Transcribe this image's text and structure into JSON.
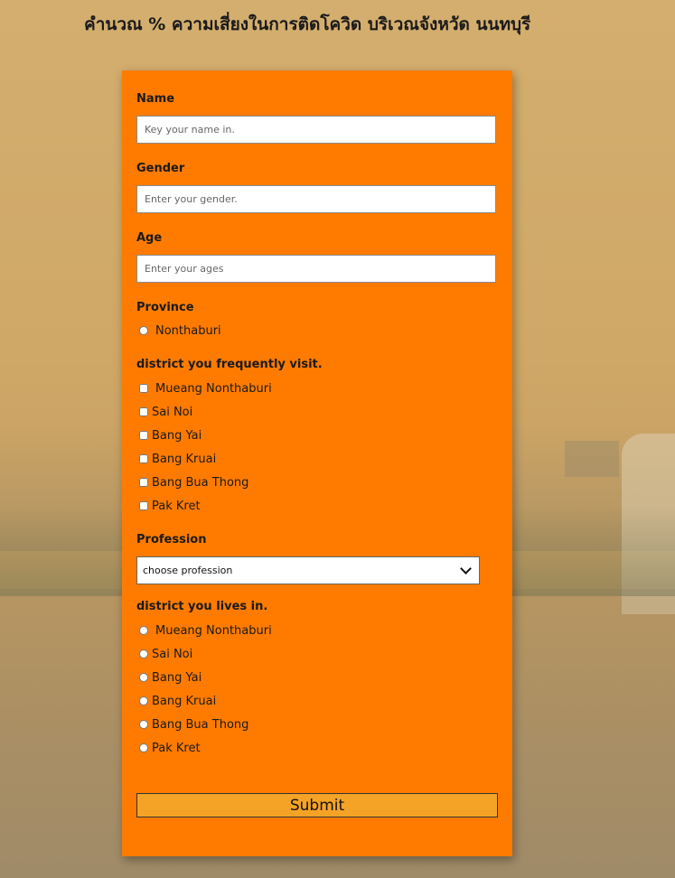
{
  "page": {
    "title": "คำนวณ % ความเสี่ยงในการติดโควิด บริเวณจังหวัด นนทบุรี"
  },
  "form": {
    "name": {
      "label": "Name",
      "value": "",
      "placeholder": "Key your name in."
    },
    "gender": {
      "label": "Gender",
      "value": "",
      "placeholder": "Enter your gender."
    },
    "age": {
      "label": "Age",
      "value": "",
      "placeholder": "Enter your ages"
    },
    "province": {
      "label": "Province",
      "options": [
        "Nonthaburi"
      ]
    },
    "visit_districts": {
      "label": "district you frequently visit.",
      "options": [
        "Mueang Nonthaburi",
        "Sai Noi",
        "Bang Yai",
        "Bang Kruai",
        "Bang Bua Thong",
        "Pak Kret"
      ]
    },
    "profession": {
      "label": "Profession",
      "selected": "choose profession"
    },
    "live_districts": {
      "label": "district you lives in.",
      "options": [
        "Mueang Nonthaburi",
        "Sai Noi",
        "Bang Yai",
        "Bang Kruai",
        "Bang Bua Thong",
        "Pak Kret"
      ]
    },
    "submit_label": "Submit"
  },
  "colors": {
    "card": "#ff7b00",
    "submit": "#f5a326",
    "background": "#d3ae6e"
  }
}
